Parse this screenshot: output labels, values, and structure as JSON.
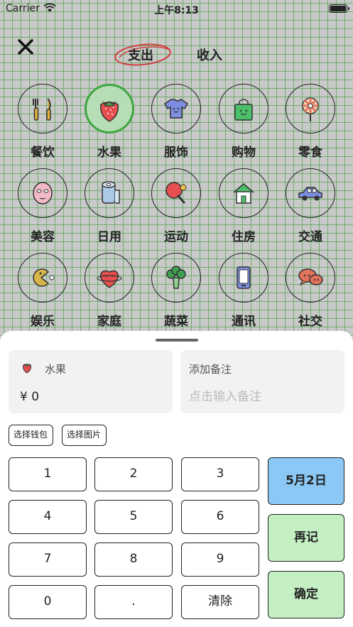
{
  "status_bar": {
    "carrier": "Carrier",
    "time": "上午8:13"
  },
  "header": {
    "tabs": {
      "expense": "支出",
      "income": "收入"
    },
    "active_tab": "expense"
  },
  "categories": [
    {
      "label": "餐饮",
      "icon": "utensils-icon"
    },
    {
      "label": "水果",
      "icon": "strawberry-icon",
      "selected": true
    },
    {
      "label": "服饰",
      "icon": "tshirt-icon"
    },
    {
      "label": "购物",
      "icon": "shopping-bag-icon"
    },
    {
      "label": "零食",
      "icon": "lollipop-icon"
    },
    {
      "label": "美容",
      "icon": "face-mask-icon"
    },
    {
      "label": "日用",
      "icon": "toilet-paper-icon"
    },
    {
      "label": "运动",
      "icon": "ping-pong-icon"
    },
    {
      "label": "住房",
      "icon": "house-icon"
    },
    {
      "label": "交通",
      "icon": "car-icon"
    },
    {
      "label": "娱乐",
      "icon": "pacman-icon"
    },
    {
      "label": "家庭",
      "icon": "heart-planet-icon"
    },
    {
      "label": "蔬菜",
      "icon": "broccoli-icon"
    },
    {
      "label": "通讯",
      "icon": "phone-icon"
    },
    {
      "label": "社交",
      "icon": "chat-bubbles-icon"
    }
  ],
  "entry": {
    "category_name": "水果",
    "amount": "¥ 0",
    "note_title": "添加备注",
    "note_placeholder": "点击输入备注"
  },
  "actions": {
    "wallet": "选择钱包",
    "image": "选择图片"
  },
  "keypad": {
    "keys": [
      "1",
      "2",
      "3",
      "4",
      "5",
      "6",
      "7",
      "8",
      "9",
      "0",
      ".",
      "清除"
    ],
    "date": "5月2日",
    "again": "再记",
    "confirm": "确定"
  },
  "colors": {
    "selected_fill": "#b7ddb7",
    "selected_border": "#3fa63f",
    "date_key": "#8cc8f5",
    "again_key": "#c3efc3",
    "confirm_key": "#c3efc3",
    "tab_circle": "#d24040"
  }
}
